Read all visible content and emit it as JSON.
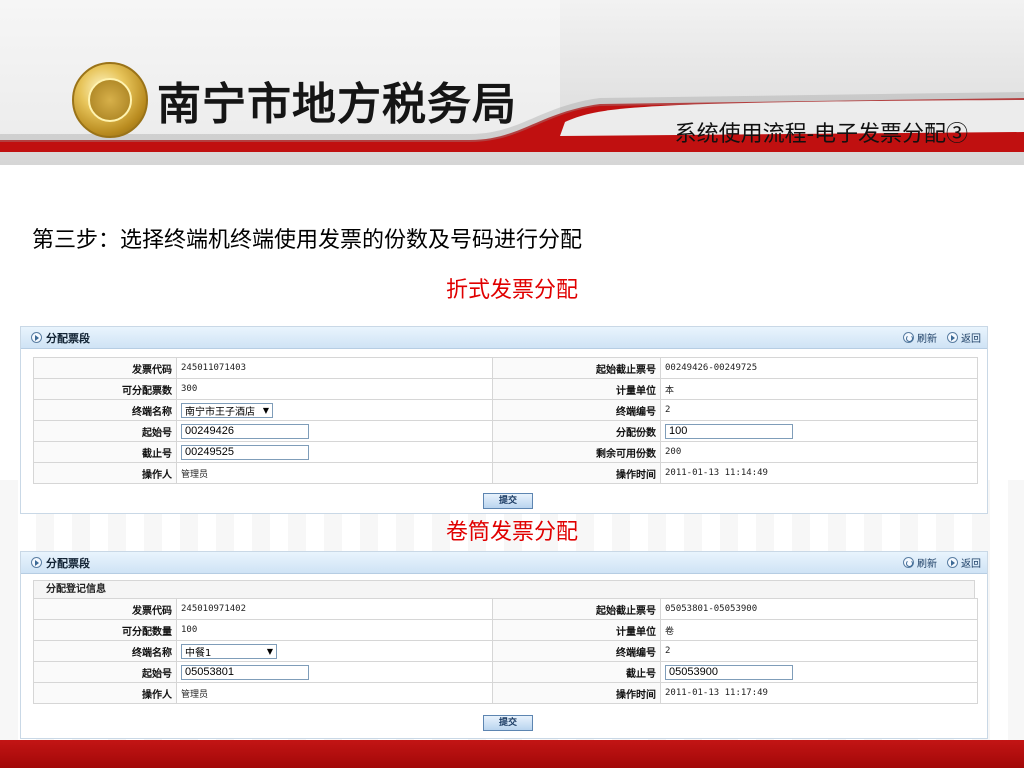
{
  "slide": {
    "org_name": "南宁市地方税务局",
    "section_title": "系统使用流程-电子发票分配③",
    "step_text": "第三步：选择终端机终端使用发票的份数及号码进行分配",
    "caption_folded": "折式发票分配",
    "caption_roll": "卷筒发票分配",
    "colors": {
      "accent_red": "#c31515",
      "caption_red": "#e00000",
      "panel_blue": "#cfe3f5"
    }
  },
  "panel1": {
    "title": "分配票段",
    "refresh_label": "刷新",
    "back_label": "返回",
    "submit_label": "提交",
    "rows": {
      "invoice_code_label": "发票代码",
      "invoice_code": "245011071403",
      "range_label": "起始截止票号",
      "range": "00249426-00249725",
      "available_label": "可分配票数",
      "available": "300",
      "unit_label": "计量单位",
      "unit": "本",
      "terminal_name_label": "终端名称",
      "terminal_name": "南宁市王子酒店",
      "terminal_no_label": "终端编号",
      "terminal_no": "2",
      "start_no_label": "起始号",
      "start_no": "00249426",
      "alloc_count_label": "分配份数",
      "alloc_count": "100",
      "end_no_label": "截止号",
      "end_no": "00249525",
      "remaining_label": "剩余可用份数",
      "remaining": "200",
      "operator_label": "操作人",
      "operator": "管理员",
      "op_time_label": "操作时间",
      "op_time": "2011-01-13 11:14:49"
    }
  },
  "panel2": {
    "title": "分配票段",
    "subhead": "分配登记信息",
    "refresh_label": "刷新",
    "back_label": "返回",
    "submit_label": "提交",
    "rows": {
      "invoice_code_label": "发票代码",
      "invoice_code": "245010971402",
      "range_label": "起始截止票号",
      "range": "05053801-05053900",
      "available_label": "可分配数量",
      "available": "100",
      "unit_label": "计量单位",
      "unit": "卷",
      "terminal_name_label": "终端名称",
      "terminal_name": "中餐1",
      "terminal_no_label": "终端编号",
      "terminal_no": "2",
      "start_no_label": "起始号",
      "start_no": "05053801",
      "end_no_label": "截止号",
      "end_no": "05053900",
      "operator_label": "操作人",
      "operator": "管理员",
      "op_time_label": "操作时间",
      "op_time": "2011-01-13 11:17:49"
    }
  }
}
